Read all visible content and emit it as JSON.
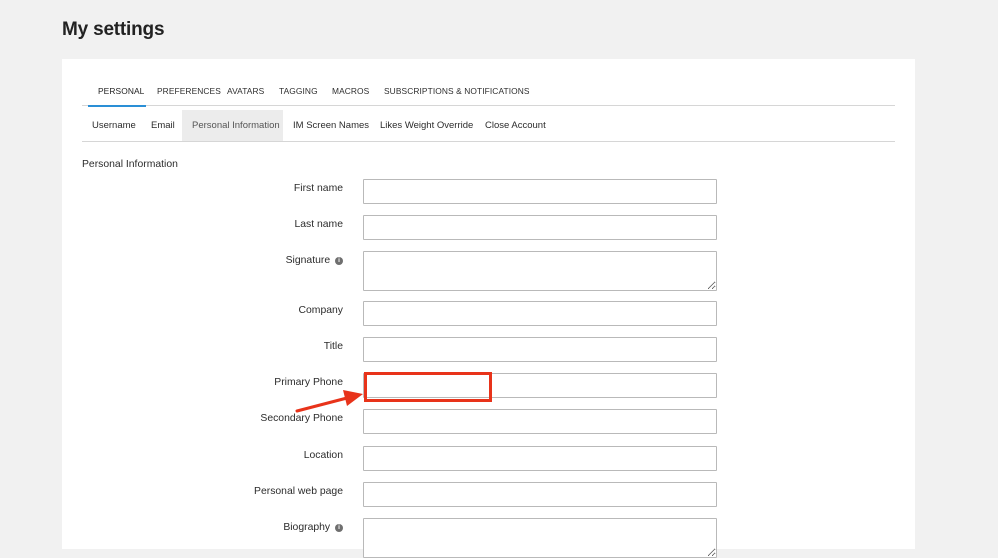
{
  "page": {
    "title": "My settings"
  },
  "tabs_top": [
    {
      "label": "PERSONAL",
      "active": true
    },
    {
      "label": "PREFERENCES",
      "active": false
    },
    {
      "label": "AVATARS",
      "active": false
    },
    {
      "label": "TAGGING",
      "active": false
    },
    {
      "label": "MACROS",
      "active": false
    },
    {
      "label": "SUBSCRIPTIONS & NOTIFICATIONS",
      "active": false
    }
  ],
  "tabs_sub": [
    {
      "label": "Username",
      "active": false
    },
    {
      "label": "Email",
      "active": false
    },
    {
      "label": "Personal Information",
      "active": true
    },
    {
      "label": "IM Screen Names",
      "active": false
    },
    {
      "label": "Likes Weight Override",
      "active": false
    },
    {
      "label": "Close Account",
      "active": false
    }
  ],
  "section": {
    "heading": "Personal Information"
  },
  "fields": {
    "first_name": {
      "label": "First name",
      "value": ""
    },
    "last_name": {
      "label": "Last name",
      "value": ""
    },
    "signature": {
      "label": "Signature",
      "value": "",
      "info_icon": "info-icon"
    },
    "company": {
      "label": "Company",
      "value": ""
    },
    "title": {
      "label": "Title",
      "value": ""
    },
    "primary_phone": {
      "label": "Primary Phone",
      "value": ""
    },
    "secondary_phone": {
      "label": "Secondary Phone",
      "value": ""
    },
    "location": {
      "label": "Location",
      "value": ""
    },
    "web_page": {
      "label": "Personal web page",
      "value": ""
    },
    "biography": {
      "label": "Biography",
      "value": "",
      "info_icon": "info-icon"
    }
  },
  "colors": {
    "active_tab_underline": "#2a8fd6",
    "annotation": "#e8331a",
    "background": "#f1f1f1"
  }
}
